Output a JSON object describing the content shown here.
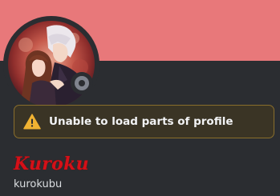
{
  "profile": {
    "banner_color": "#e8787a",
    "status": "offline",
    "display_name": "Kuroku",
    "username": "kurokubu"
  },
  "notice": {
    "icon": "warning-icon",
    "text": "Unable to load parts of profile"
  },
  "colors": {
    "background": "#2b2d31",
    "warning": "#f0b232",
    "display_name": "#d41018"
  }
}
